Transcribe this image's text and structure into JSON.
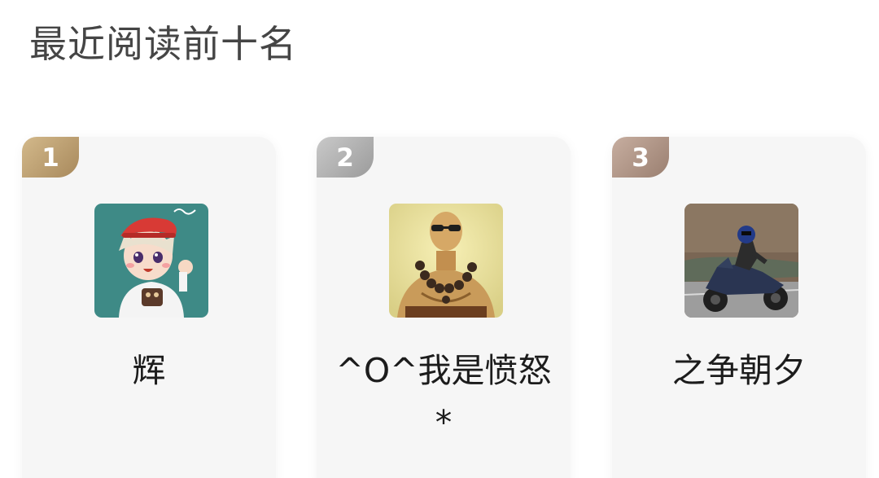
{
  "header": {
    "title": "最近阅读前十名"
  },
  "readers": [
    {
      "rank": "1",
      "name": "辉",
      "avatar_icon": "cartoon-boy-avatar",
      "rank_color": "#c4a677"
    },
    {
      "rank": "2",
      "name": "^O^我是愤怒*",
      "avatar_icon": "bald-monk-avatar",
      "rank_color": "#b3b3b3"
    },
    {
      "rank": "3",
      "name": "之争朝夕",
      "avatar_icon": "motorcycle-rider-avatar",
      "rank_color": "#b39a8c"
    }
  ]
}
